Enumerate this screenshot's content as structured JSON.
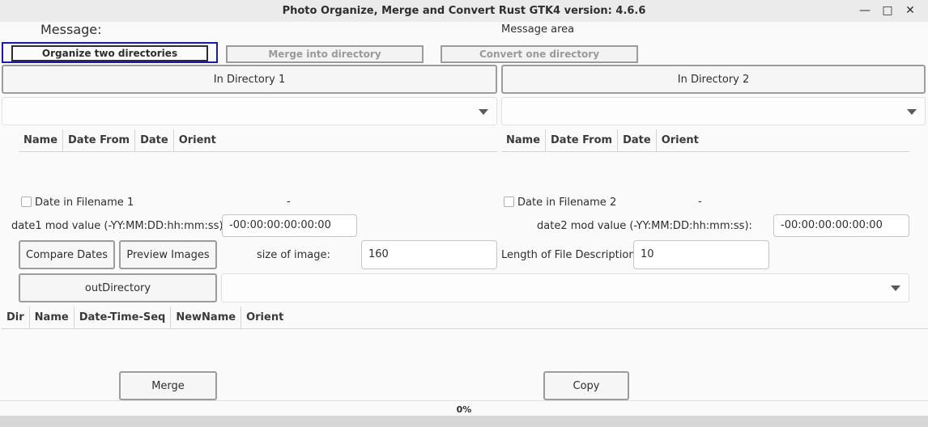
{
  "window": {
    "title": "Photo Organize, Merge and Convert Rust GTK4 version: 4.6.6",
    "minimize_glyph": "—",
    "maximize_glyph": "□",
    "close_glyph": "✕"
  },
  "message": {
    "label": "Message:",
    "area": "Message area"
  },
  "tabs": [
    {
      "label": "Organize two directories",
      "active": true
    },
    {
      "label": "Merge into directory",
      "active": false
    },
    {
      "label": "Convert one directory",
      "active": false
    }
  ],
  "dir1": {
    "button": "In Directory 1",
    "columns": [
      "Name",
      "Date From",
      "Date",
      "Orient"
    ],
    "date_in_filename": "Date in Filename 1",
    "status": "-",
    "mod_label": "date1 mod value (-YY:MM:DD:hh:mm:ss):",
    "mod_value": "-00:00:00:00:00:00"
  },
  "dir2": {
    "button": "In Directory 2",
    "columns": [
      "Name",
      "Date From",
      "Date",
      "Orient"
    ],
    "date_in_filename": "Date in Filename 2",
    "status": "-",
    "mod_label": "date2 mod value (-YY:MM:DD:hh:mm:ss):",
    "mod_value": "-00:00:00:00:00:00"
  },
  "controls": {
    "compare_dates": "Compare Dates",
    "preview_images": "Preview Images",
    "size_label": "size of image:",
    "size_value": "160",
    "length_label": "Length of File Description:",
    "length_value": "10",
    "out_directory": "outDirectory"
  },
  "output": {
    "columns": [
      "Dir",
      "Name",
      "Date-Time-Seq",
      "NewName",
      "Orient"
    ]
  },
  "actions": {
    "merge": "Merge",
    "copy": "Copy"
  },
  "progress": {
    "text": "0%",
    "fraction": 0.0
  }
}
